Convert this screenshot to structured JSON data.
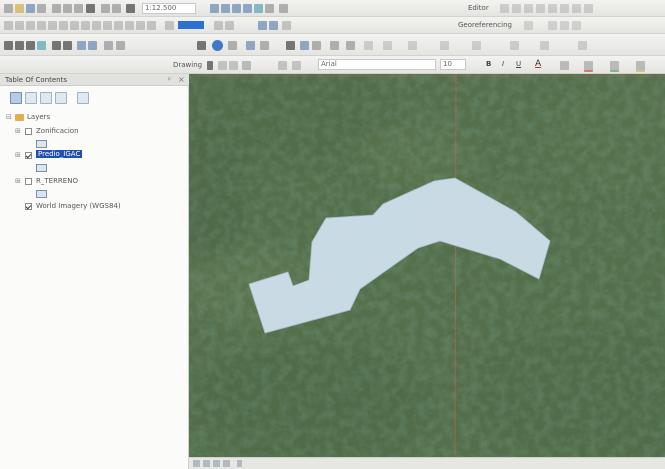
{
  "toolbar": {
    "scale": "1:12.500",
    "editor_label": "Editor",
    "georef_label": "Georeferencing",
    "drawing_label": "Drawing",
    "font_name": "Arial",
    "font_size": "10",
    "bold": "B",
    "italic": "I",
    "underline": "U",
    "text_color": "A"
  },
  "toc": {
    "title": "Table Of Contents",
    "pin": "ᵖ",
    "close": "×",
    "root_label": "Layers",
    "layers": [
      {
        "label": "Zonificacion",
        "checked": false
      },
      {
        "label": "Predio_IGAC",
        "checked": true,
        "selected": true
      },
      {
        "label": "R_TERRENO",
        "checked": false
      },
      {
        "label": "World Imagery (WGS84)",
        "checked": true
      }
    ]
  },
  "colors": {
    "polygon_fill": "#cfe0ec",
    "selection": "#1f4fb0",
    "guide_line": "#d06a5a"
  }
}
